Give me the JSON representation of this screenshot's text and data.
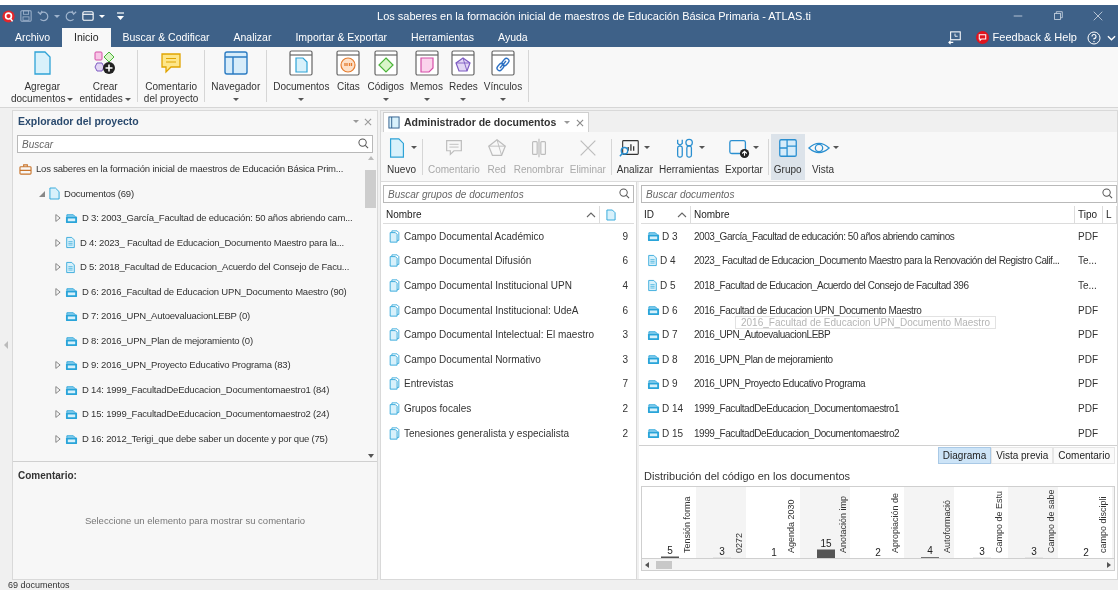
{
  "window": {
    "title": "Los saberes en la formación inicial de maestros de Educación Básica Primaria - ATLAS.ti"
  },
  "ribbon_tabs": [
    {
      "label": "Archivo",
      "selected": false
    },
    {
      "label": "Inicio",
      "selected": true
    },
    {
      "label": "Buscar & Codificar",
      "selected": false
    },
    {
      "label": "Analizar",
      "selected": false
    },
    {
      "label": "Importar & Exportar",
      "selected": false
    },
    {
      "label": "Herramientas",
      "selected": false
    },
    {
      "label": "Ayuda",
      "selected": false
    }
  ],
  "help": {
    "label": "Feedback & Help"
  },
  "ribbon_groups": [
    [
      {
        "kind": "add_document",
        "lines": [
          "Agregar",
          "documentos"
        ],
        "dropdown": true
      },
      {
        "kind": "create",
        "lines": [
          "Crear",
          "entidades"
        ],
        "dropdown": true
      }
    ],
    [
      {
        "kind": "comment",
        "lines": [
          "Comentario",
          "del proyecto"
        ],
        "dropdown": false
      }
    ],
    [
      {
        "kind": "navigator",
        "lines": [
          "Navegador"
        ],
        "dropdown": true
      }
    ],
    [
      {
        "kind": "documents",
        "lines": [
          "Documentos"
        ],
        "dropdown": true
      },
      {
        "kind": "quotes",
        "lines": [
          "Citas"
        ],
        "dropdown": false
      },
      {
        "kind": "codes",
        "lines": [
          "Códigos"
        ],
        "dropdown": true
      },
      {
        "kind": "memos",
        "lines": [
          "Memos"
        ],
        "dropdown": true
      },
      {
        "kind": "networks",
        "lines": [
          "Redes"
        ],
        "dropdown": true
      },
      {
        "kind": "links",
        "lines": [
          "Vínculos"
        ],
        "dropdown": true
      }
    ]
  ],
  "explorer": {
    "title": "Explorador del proyecto",
    "search_placeholder": "Buscar",
    "project": "Los saberes en la formación inicial de maestros de Educación Básica Prim...",
    "tree": [
      {
        "label": "Documentos (69)",
        "expanded": true,
        "children": [
          {
            "label": "D 3: 2003_García_Facultad de educación: 50 años abriendo cam...",
            "kind": "pdf",
            "expandable": true
          },
          {
            "label": "D 4: 2023_ Facultad de Educacion_Documento Maestro para la...",
            "kind": "text",
            "expandable": true
          },
          {
            "label": "D 5: 2018_Facultad de Educacion_Acuerdo del Consejo de Facu...",
            "kind": "text",
            "expandable": true
          },
          {
            "label": "D 6: 2016_Facultad de Educacion UPN_Documento Maestro (90)",
            "kind": "pdf",
            "expandable": true
          },
          {
            "label": "D 7: 2016_UPN_AutoevaluacionLEBP (0)",
            "kind": "pdf",
            "expandable": false
          },
          {
            "label": "D 8: 2016_UPN_Plan de mejoramiento (0)",
            "kind": "pdf",
            "expandable": false
          },
          {
            "label": "D 9: 2016_UPN_Proyecto Educativo Programa (83)",
            "kind": "pdf",
            "expandable": true
          },
          {
            "label": "D 14: 1999_FacultadDeEducacion_Documentomaestro1 (84)",
            "kind": "pdf",
            "expandable": true
          },
          {
            "label": "D 15: 1999_FacultadDeEducacion_Documentomaestro2 (24)",
            "kind": "pdf",
            "expandable": true
          },
          {
            "label": "D 16: 2012_Terigi_que debe saber un docente y por que (75)",
            "kind": "pdf",
            "expandable": true
          }
        ]
      }
    ]
  },
  "comment_pane": {
    "label": "Comentario:",
    "hint": "Seleccione un elemento para mostrar su comentario"
  },
  "document_manager": {
    "tab": "Administrador de documentos",
    "toolbar": [
      [
        {
          "kind": "new",
          "label": "Nuevo",
          "dropdown": true,
          "disabled": false,
          "selected": false
        }
      ],
      [
        {
          "kind": "comment",
          "label": "Comentario",
          "dropdown": false,
          "disabled": true,
          "selected": false
        },
        {
          "kind": "network",
          "label": "Red",
          "dropdown": false,
          "disabled": true,
          "selected": false
        },
        {
          "kind": "rename",
          "label": "Renombrar",
          "dropdown": false,
          "disabled": true,
          "selected": false
        },
        {
          "kind": "delete",
          "label": "Eliminar",
          "dropdown": false,
          "disabled": true,
          "selected": false
        }
      ],
      [
        {
          "kind": "analyze",
          "label": "Analizar",
          "dropdown": true,
          "disabled": false,
          "selected": false
        },
        {
          "kind": "tools",
          "label": "Herramientas",
          "dropdown": true,
          "disabled": false,
          "selected": false
        },
        {
          "kind": "export",
          "label": "Exportar",
          "dropdown": true,
          "disabled": false,
          "selected": false
        }
      ],
      [
        {
          "kind": "group",
          "label": "Grupo",
          "dropdown": false,
          "disabled": false,
          "selected": true
        },
        {
          "kind": "view",
          "label": "Vista",
          "dropdown": true,
          "disabled": false,
          "selected": false
        }
      ]
    ],
    "groups": {
      "search_placeholder": "Buscar grupos de documentos",
      "columns": [
        {
          "label": "Nombre",
          "sorted": true
        }
      ],
      "rows": [
        {
          "name": "Campo Documental Académico",
          "count": "9"
        },
        {
          "name": "Campo Documental Difusión",
          "count": "6"
        },
        {
          "name": "Campo Documental Institucional UPN",
          "count": "4"
        },
        {
          "name": "Campo Documental Institucional: UdeA",
          "count": "6"
        },
        {
          "name": "Campo Documental Intelectual: El maestro",
          "count": "3"
        },
        {
          "name": "Campo Documental Normativo",
          "count": "3"
        },
        {
          "name": "Entrevistas",
          "count": "7"
        },
        {
          "name": "Grupos focales",
          "count": "2"
        },
        {
          "name": "Tenesiones generalista y especialista",
          "count": "2"
        }
      ]
    },
    "documents": {
      "search_placeholder": "Buscar documentos",
      "columns": [
        {
          "label": "ID",
          "sorted": true
        },
        {
          "label": "Nombre",
          "sorted": false
        },
        {
          "label": "Tipo",
          "sorted": false
        },
        {
          "label": "L",
          "sorted": false
        }
      ],
      "rows": [
        {
          "id": "D 3",
          "name": "2003_García_Facultad de educación: 50 años abriendo caminos",
          "type": "PDF",
          "kind": "pdf"
        },
        {
          "id": "D 4",
          "name": "2023_ Facultad de Educacion_Documento Maestro para la Renovación del Registro Calif...",
          "type": "Te...",
          "kind": "text"
        },
        {
          "id": "D 5",
          "name": "2018_Facultad de Educacion_Acuerdo del Consejo de Facultad 396",
          "type": "Te...",
          "kind": "text"
        },
        {
          "id": "D 6",
          "name": "2016_Facultad de Educacion UPN_Documento Maestro",
          "type": "PDF",
          "kind": "pdf"
        },
        {
          "id": "D 7",
          "name": "2016_UPN_AutoevaluacionLEBP",
          "type": "PDF",
          "kind": "pdf"
        },
        {
          "id": "D 8",
          "name": "2016_UPN_Plan de mejoramiento",
          "type": "PDF",
          "kind": "pdf"
        },
        {
          "id": "D 9",
          "name": "2016_UPN_Proyecto Educativo Programa",
          "type": "PDF",
          "kind": "pdf"
        },
        {
          "id": "D 14",
          "name": "1999_FacultadDeEducacion_Documentomaestro1",
          "type": "PDF",
          "kind": "pdf"
        },
        {
          "id": "D 15",
          "name": "1999_FacultadDeEducacion_Documentomaestro2",
          "type": "PDF",
          "kind": "pdf"
        }
      ],
      "tooltip": "2016_Facultad de Educacion UPN_Documento Maestro"
    },
    "detail_tabs": [
      {
        "label": "Diagrama",
        "selected": true
      },
      {
        "label": "Vista previa",
        "selected": false
      },
      {
        "label": "Comentario",
        "selected": false
      }
    ],
    "chart": {
      "chart_data": {
        "type": "bar",
        "title": "Distribución del código en los documentos",
        "categories": [
          "Tensión forma",
          "0272",
          "Agenda 2030",
          "Anotación imp",
          "Apropiación de",
          "Autoformació",
          "Campo de Estu",
          "Campo de sabe",
          "campo discipli"
        ],
        "values": [
          5,
          3,
          1,
          15,
          2,
          4,
          3,
          3,
          2
        ],
        "data_labels": true
      }
    }
  },
  "status_bar": "69 documentos"
}
